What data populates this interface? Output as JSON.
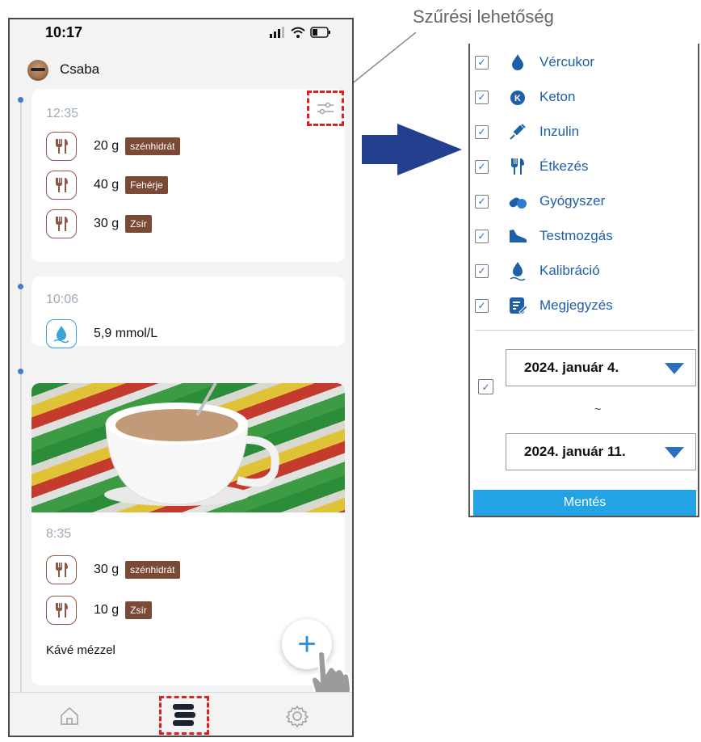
{
  "annotation": {
    "label": "Szűrési lehetőség"
  },
  "phone": {
    "status_time": "10:17",
    "user_name": "Csaba",
    "entries": [
      {
        "time": "12:35",
        "items": [
          {
            "amount": "20 g",
            "tag": "szénhidrát"
          },
          {
            "amount": "40 g",
            "tag": "Fehérje"
          },
          {
            "amount": "30 g",
            "tag": "Zsír"
          }
        ]
      },
      {
        "time": "10:06",
        "reading": "5,9 mmol/L"
      },
      {
        "time": "8:35",
        "items": [
          {
            "amount": "30 g",
            "tag": "szénhidrát"
          },
          {
            "amount": "10 g",
            "tag": "Zsír"
          }
        ],
        "note": "Kávé mézzel"
      }
    ],
    "fab_symbol": "+",
    "nav": [
      {
        "icon": "home-icon"
      },
      {
        "icon": "list-icon"
      },
      {
        "icon": "gear-icon"
      }
    ]
  },
  "filter_panel": {
    "items": [
      {
        "label": "Vércukor",
        "icon": "drop-icon",
        "checked": true
      },
      {
        "label": "Keton",
        "icon": "ketone-icon",
        "checked": true
      },
      {
        "label": "Inzulin",
        "icon": "syringe-icon",
        "checked": true
      },
      {
        "label": "Étkezés",
        "icon": "cutlery-icon",
        "checked": true
      },
      {
        "label": "Gyógyszer",
        "icon": "pills-icon",
        "checked": true
      },
      {
        "label": "Testmozgás",
        "icon": "shoe-icon",
        "checked": true
      },
      {
        "label": "Kalibráció",
        "icon": "calibration-icon",
        "checked": true
      },
      {
        "label": "Megjegyzés",
        "icon": "note-icon",
        "checked": true
      }
    ],
    "date_filter_checked": true,
    "date_from": "2024. január 4.",
    "separator": "~",
    "date_to": "2024. január 11.",
    "save_label": "Mentés"
  },
  "colors": {
    "accent": "#2a6fc0",
    "save_button": "#23a3e6",
    "tag": "#7a4a36",
    "highlight": "#e02020"
  }
}
